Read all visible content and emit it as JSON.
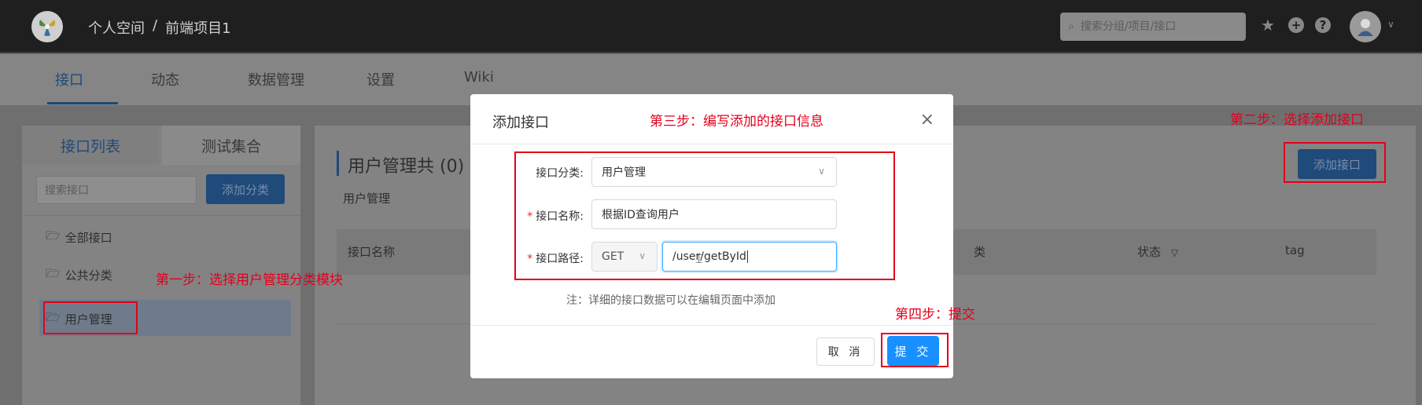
{
  "header": {
    "breadcrumb": [
      "个人空间",
      "前端项目1"
    ],
    "breadcrumb_separator": "/",
    "search_placeholder": "搜索分组/项目/接口",
    "icons": [
      "star-icon",
      "plus-circle-icon",
      "help-icon",
      "avatar",
      "chevron-down-icon"
    ]
  },
  "tabs": [
    {
      "label": "接口",
      "active": true
    },
    {
      "label": "动态",
      "active": false
    },
    {
      "label": "数据管理",
      "active": false
    },
    {
      "label": "设置",
      "active": false
    },
    {
      "label": "Wiki",
      "active": false
    }
  ],
  "sidebar": {
    "tab_list": "接口列表",
    "tab_collection": "测试集合",
    "search_placeholder": "搜索接口",
    "add_category": "添加分类",
    "items": [
      {
        "label": "全部接口"
      },
      {
        "label": "公共分类"
      },
      {
        "label": "用户管理",
        "selected": true
      }
    ]
  },
  "content": {
    "title": "用户管理共 (0) ↑",
    "subtitle": "用户管理",
    "add_api": "添加接口",
    "columns": [
      "接口名称",
      "类",
      "状态",
      "tag"
    ]
  },
  "modal": {
    "title": "添加接口",
    "close": "×",
    "fields": {
      "category_label": "接口分类:",
      "category_value": "用户管理",
      "name_label": "接口名称:",
      "name_value": "根据ID查询用户",
      "path_label": "接口路径:",
      "method_value": "GET",
      "path_value": "/user/getById"
    },
    "note": "注：详细的接口数据可以在编辑页面中添加",
    "cancel": "取 消",
    "submit": "提 交"
  },
  "annotations": {
    "step1": "第一步：选择用户管理分类模块",
    "step2": "第二步：选择添加接口",
    "step3": "第三步：编写添加的接口信息",
    "step4": "第四步：提交"
  },
  "colors": {
    "primary": "#1890ff",
    "annotation": "#e3001b",
    "overlay_topbar": "#1f1f1f"
  }
}
